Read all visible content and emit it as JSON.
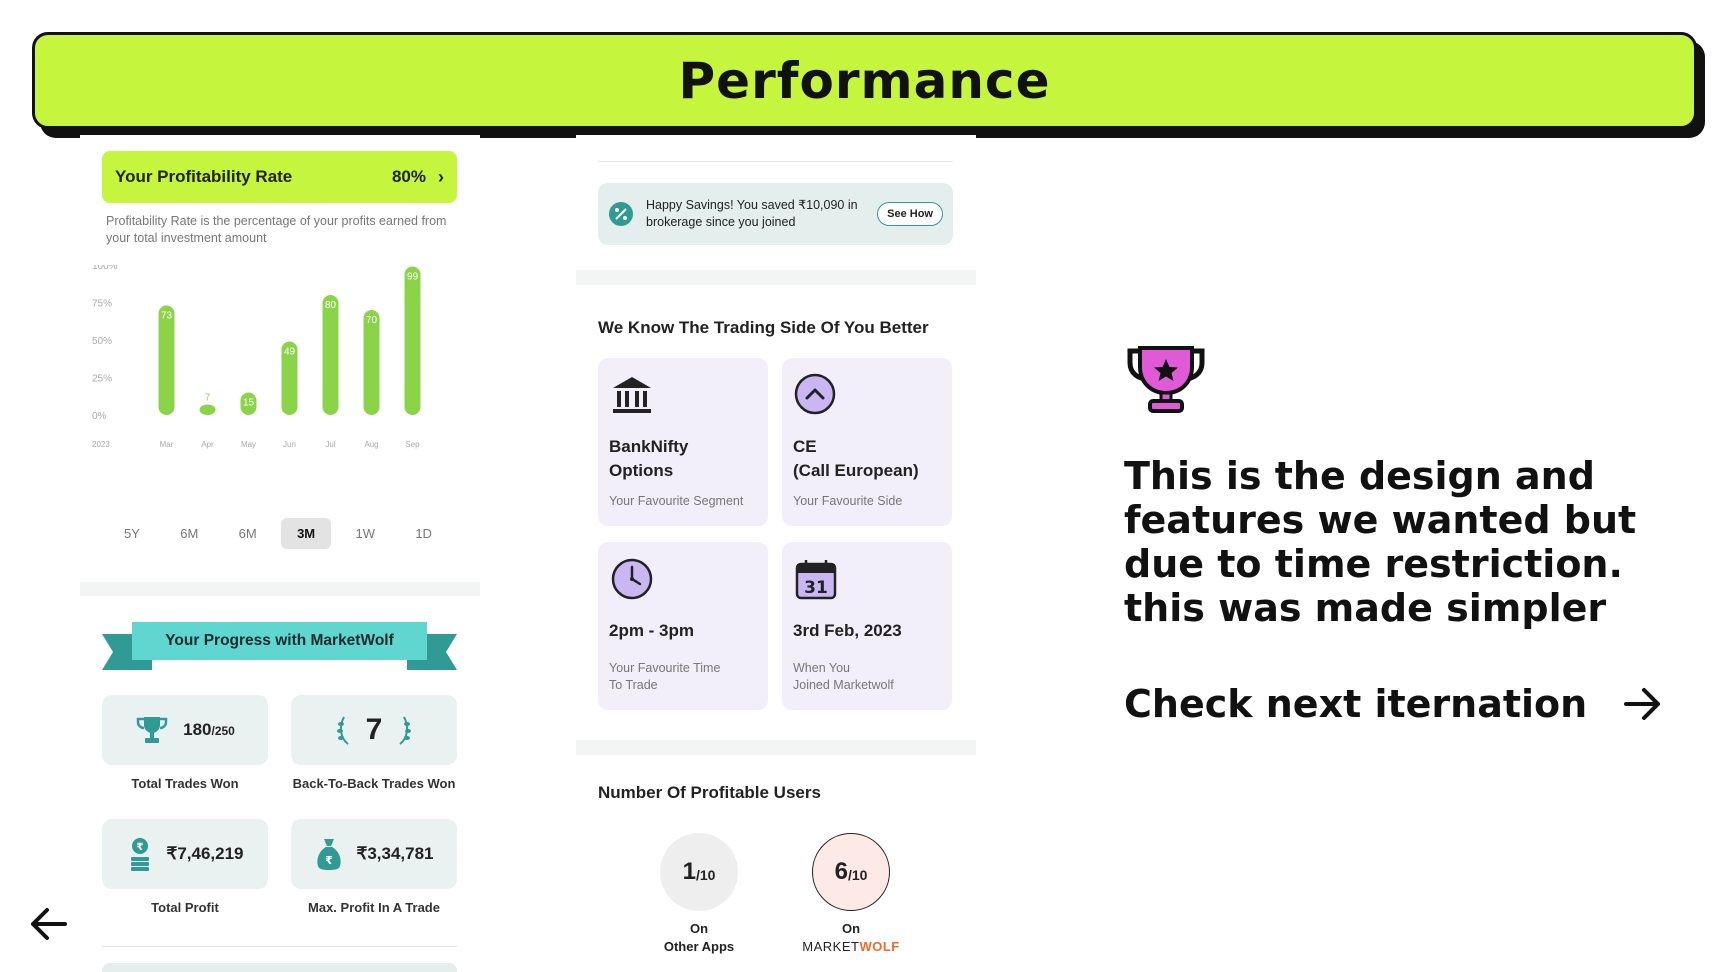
{
  "header": {
    "title": "Performance"
  },
  "profitability": {
    "title": "Your Profitability Rate",
    "rate": "80%",
    "description": "Profitability Rate is the percentage of your profits earned from your total investment amount"
  },
  "chart_data": {
    "type": "bar",
    "categories": [
      "Mar",
      "Apr",
      "May",
      "Jun",
      "Jul",
      "Aug",
      "Sep"
    ],
    "year_label": "2023",
    "values": [
      73,
      7,
      15,
      49,
      80,
      70,
      99
    ],
    "y_ticks": [
      "100%",
      "75%",
      "50%",
      "25%",
      "0%"
    ],
    "ylim": [
      0,
      100
    ],
    "bar_color": "#8bd44a"
  },
  "range_tabs": [
    "5Y",
    "6M",
    "6M",
    "3M",
    "1W",
    "1D"
  ],
  "range_active_index": 3,
  "progress": {
    "title": "Your Progress with MarketWolf",
    "trades_won": "180",
    "trades_total": "/250",
    "trades_won_label": "Total Trades Won",
    "streak": "7",
    "streak_label": "Back-To-Back Trades Won",
    "total_profit": "₹7,46,219",
    "total_profit_label": "Total Profit",
    "max_profit": "₹3,34,781",
    "max_profit_label": "Max. Profit In A Trade"
  },
  "savings": {
    "text": "Happy Savings! You saved ₹10,090 in brokerage since you joined",
    "button": "See How"
  },
  "trading_side": {
    "title": "We Know The Trading Side Of You Better",
    "tiles": [
      {
        "icon": "bank-icon",
        "value": "BankNifty\nOptions",
        "sub": "Your Favourite Segment"
      },
      {
        "icon": "arrow-up-circle-icon",
        "value": "CE\n(Call European)",
        "sub": "Your Favourite Side"
      },
      {
        "icon": "clock-icon",
        "value": "2pm - 3pm",
        "sub": "Your Favourite Time\nTo Trade"
      },
      {
        "icon": "calendar-icon",
        "value": "3rd Feb, 2023",
        "sub": "When You\nJoined Marketwolf",
        "calendar_day": "31"
      }
    ]
  },
  "profitable_users": {
    "title": "Number Of Profitable Users",
    "other_value": "1",
    "other_total": "/10",
    "other_label_1": "On",
    "other_label_2": "Other Apps",
    "mw_value": "6",
    "mw_total": "/10",
    "mw_label_1": "On",
    "mw_brand_a": "MARKET",
    "mw_brand_b": "WOLF"
  },
  "right": {
    "message": "This is the design and features we wanted but due to time restriction. this was made simpler",
    "next_label": "Check next iternation"
  },
  "colors": {
    "accent": "#c5f53c",
    "teal": "#2f9b94",
    "tile_bg": "#f2effa",
    "brand_orange": "#f06a2b"
  }
}
